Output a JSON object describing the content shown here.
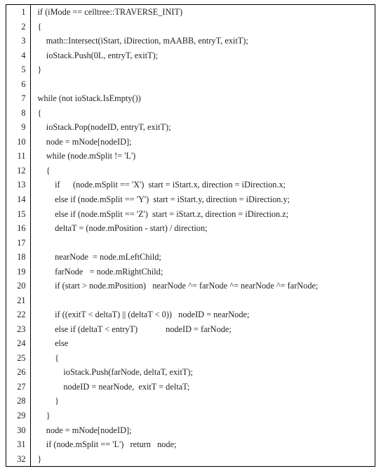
{
  "lines": [
    {
      "n": "1",
      "code": "if (iMode == celltree::TRAVERSE_INIT)"
    },
    {
      "n": "2",
      "code": "{"
    },
    {
      "n": "3",
      "code": "    math::Intersect(iStart, iDirection, mAABB, entryT, exitT);"
    },
    {
      "n": "4",
      "code": "    ioStack.Push(0L, entryT, exitT);"
    },
    {
      "n": "5",
      "code": "}"
    },
    {
      "n": "6",
      "code": ""
    },
    {
      "n": "7",
      "code": "while (not ioStack.IsEmpty())"
    },
    {
      "n": "8",
      "code": "{"
    },
    {
      "n": "9",
      "code": "    ioStack.Pop(nodeID, entryT, exitT);"
    },
    {
      "n": "10",
      "code": "    node = mNode[nodeID];"
    },
    {
      "n": "11",
      "code": "    while (node.mSplit != 'L')"
    },
    {
      "n": "12",
      "code": "    {"
    },
    {
      "n": "13",
      "code": "        if      (node.mSplit == 'X')  start = iStart.x, direction = iDirection.x;"
    },
    {
      "n": "14",
      "code": "        else if (node.mSplit == 'Y')  start = iStart.y, direction = iDirection.y;"
    },
    {
      "n": "15",
      "code": "        else if (node.mSplit == 'Z')  start = iStart.z, direction = iDirection.z;"
    },
    {
      "n": "16",
      "code": "        deltaT = (node.mPosition - start) / direction;"
    },
    {
      "n": "17",
      "code": ""
    },
    {
      "n": "18",
      "code": "        nearNode  = node.mLeftChild;"
    },
    {
      "n": "19",
      "code": "        farNode   = node.mRightChild;"
    },
    {
      "n": "20",
      "code": "        if (start > node.mPosition)   nearNode ^= farNode ^= nearNode ^= farNode;"
    },
    {
      "n": "21",
      "code": ""
    },
    {
      "n": "22",
      "code": "        if ((exitT < deltaT) || (deltaT < 0))   nodeID = nearNode;"
    },
    {
      "n": "23",
      "code": "        else if (deltaT < entryT)             nodeID = farNode;"
    },
    {
      "n": "24",
      "code": "        else"
    },
    {
      "n": "25",
      "code": "        {"
    },
    {
      "n": "26",
      "code": "            ioStack.Push(farNode, deltaT, exitT);"
    },
    {
      "n": "27",
      "code": "            nodeID = nearNode,  exitT = deltaT;"
    },
    {
      "n": "28",
      "code": "        }"
    },
    {
      "n": "29",
      "code": "    }"
    },
    {
      "n": "30",
      "code": "    node = mNode[nodeID];"
    },
    {
      "n": "31",
      "code": "    if (node.mSplit == 'L')   return   node;"
    },
    {
      "n": "32",
      "code": "}"
    }
  ]
}
